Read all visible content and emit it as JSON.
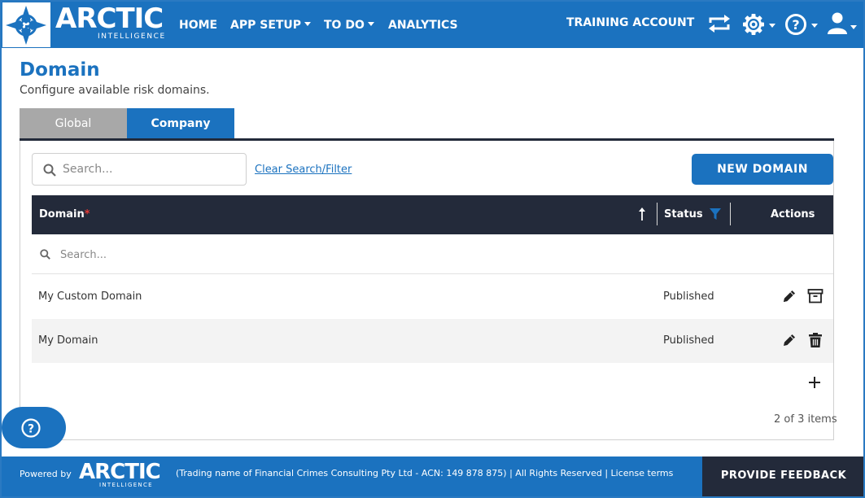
{
  "header": {
    "brand": "ARCTIC",
    "brand_sub": "INTELLIGENCE",
    "nav": [
      {
        "label": "HOME",
        "dropdown": false
      },
      {
        "label": "APP SETUP",
        "dropdown": true
      },
      {
        "label": "TO DO",
        "dropdown": true
      },
      {
        "label": "ANALYTICS",
        "dropdown": false
      }
    ],
    "account_label": "TRAINING ACCOUNT",
    "icons": [
      "switch-account-icon",
      "gear-icon",
      "help-circle-icon",
      "user-icon"
    ]
  },
  "page": {
    "title": "Domain",
    "subtitle": "Configure available risk domains."
  },
  "tabs": [
    {
      "label": "Global",
      "active": false
    },
    {
      "label": "Company",
      "active": true
    }
  ],
  "toolbar": {
    "search_placeholder": "Search...",
    "clear_label": "Clear Search/Filter",
    "new_button_label": "NEW DOMAIN"
  },
  "grid": {
    "columns": [
      {
        "label": "Domain",
        "required_mark": "*"
      },
      {
        "label": "Status"
      },
      {
        "label": "Actions"
      }
    ],
    "filter_placeholder": "Search...",
    "rows": [
      {
        "domain": "My Custom Domain",
        "status": "Published",
        "actions": [
          "edit",
          "archive"
        ]
      },
      {
        "domain": "My Domain",
        "status": "Published",
        "actions": [
          "edit",
          "delete"
        ]
      }
    ],
    "items_count": "2 of 3 items"
  },
  "footer": {
    "powered_by": "Powered by",
    "brand": "ARCTIC",
    "brand_sub": "INTELLIGENCE",
    "legal_text": "(Trading name of Financial Crimes Consulting Pty Ltd - ACN: 149 878 875)",
    "rights": "| All Rights Reserved",
    "license": "| License terms",
    "feedback_label": "PROVIDE FEEDBACK"
  },
  "colors": {
    "primary": "#1b72bf",
    "dark": "#232a3a",
    "inactive_tab": "#a8a8a8",
    "required": "#e53935"
  }
}
